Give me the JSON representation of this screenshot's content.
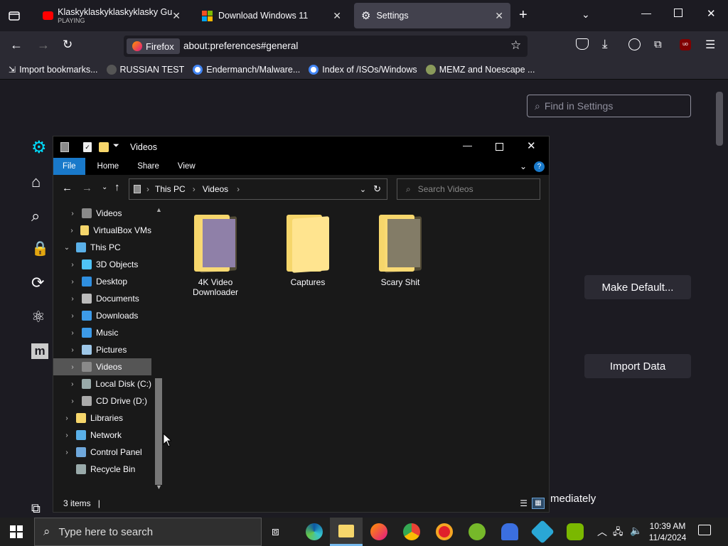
{
  "browser": {
    "tabs": [
      {
        "title": "Klaskyklaskyklaskyklasky Gumm",
        "subtitle": "PLAYING"
      },
      {
        "title": "Download Windows 11"
      },
      {
        "title": "Settings"
      }
    ],
    "identity_label": "Firefox",
    "url": "about:preferences#general",
    "bookmarks": [
      {
        "label": "Import bookmarks..."
      },
      {
        "label": "RUSSIAN TEST"
      },
      {
        "label": "Endermanch/Malware..."
      },
      {
        "label": "Index of /ISOs/Windows"
      },
      {
        "label": "MEMZ and Noescape ..."
      }
    ]
  },
  "settings": {
    "search_placeholder": "Find in Settings",
    "make_default_label": "Make Default...",
    "import_data_label": "Import Data",
    "partial_text": "mediately"
  },
  "explorer": {
    "title": "Videos",
    "ribbon_tabs": [
      "File",
      "Home",
      "Share",
      "View"
    ],
    "breadcrumb": [
      "This PC",
      "Videos"
    ],
    "search_placeholder": "Search Videos",
    "nav": [
      {
        "label": "Videos",
        "indent": 1,
        "arrow": "›",
        "color": "#8a8a8a"
      },
      {
        "label": "VirtualBox VMs",
        "indent": 1,
        "arrow": "›",
        "color": "#f6d66b"
      },
      {
        "label": "This PC",
        "indent": 0,
        "arrow": "⌄",
        "color": "#5ab0e8"
      },
      {
        "label": "3D Objects",
        "indent": 1,
        "arrow": "›",
        "color": "#4fc3f7"
      },
      {
        "label": "Desktop",
        "indent": 1,
        "arrow": "›",
        "color": "#2f8fe0"
      },
      {
        "label": "Documents",
        "indent": 1,
        "arrow": "›",
        "color": "#bbbbbb"
      },
      {
        "label": "Downloads",
        "indent": 1,
        "arrow": "›",
        "color": "#3d9be9"
      },
      {
        "label": "Music",
        "indent": 1,
        "arrow": "›",
        "color": "#3d9be9"
      },
      {
        "label": "Pictures",
        "indent": 1,
        "arrow": "›",
        "color": "#9ec7e8"
      },
      {
        "label": "Videos",
        "indent": 1,
        "arrow": "›",
        "color": "#8a8a8a",
        "selected": true
      },
      {
        "label": "Local Disk (C:)",
        "indent": 1,
        "arrow": "›",
        "color": "#9aa"
      },
      {
        "label": "CD Drive (D:)",
        "indent": 1,
        "arrow": "›",
        "color": "#aaa"
      },
      {
        "label": "Libraries",
        "indent": 0,
        "arrow": "›",
        "color": "#f6d66b"
      },
      {
        "label": "Network",
        "indent": 0,
        "arrow": "›",
        "color": "#5ab0e8"
      },
      {
        "label": "Control Panel",
        "indent": 0,
        "arrow": "›",
        "color": "#6fa8dc"
      },
      {
        "label": "Recycle Bin",
        "indent": 0,
        "arrow": "",
        "color": "#9aa"
      }
    ],
    "items": [
      {
        "name": "4K Video Downloader",
        "overlay": "#6a5fb0"
      },
      {
        "name": "Captures",
        "overlay": ""
      },
      {
        "name": "Scary Shit",
        "overlay": "#5a5a5a"
      }
    ],
    "status": "3 items"
  },
  "taskbar": {
    "search_placeholder": "Type here to search",
    "time": "10:39 AM",
    "date": "11/4/2024"
  }
}
